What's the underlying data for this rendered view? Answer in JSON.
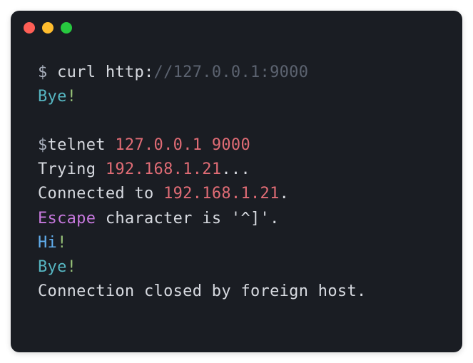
{
  "titlebar": {
    "buttons": [
      "close",
      "minimize",
      "zoom"
    ]
  },
  "lines": {
    "l1": {
      "prompt": "$ ",
      "cmd": "curl http:",
      "url": "//127.0.0.1:9000"
    },
    "l2": {
      "text": "Bye",
      "bang": "!"
    },
    "l3": {
      "prompt": "$",
      "cmd": "telnet ",
      "ip": "127.0.0.1",
      "sp": " ",
      "port": "9000"
    },
    "l4": {
      "text": "Trying ",
      "ip": "192.168.1.21",
      "dots": "..."
    },
    "l5": {
      "text": "Connected to ",
      "ip": "192.168.1.21",
      "dot": "."
    },
    "l6": {
      "word": "Escape",
      "rest": " character is '^]'."
    },
    "l7": {
      "text": "Hi",
      "bang": "!"
    },
    "l8": {
      "text": "Bye",
      "bang": "!"
    },
    "l9": {
      "text": "Connection closed by foreign host."
    }
  }
}
